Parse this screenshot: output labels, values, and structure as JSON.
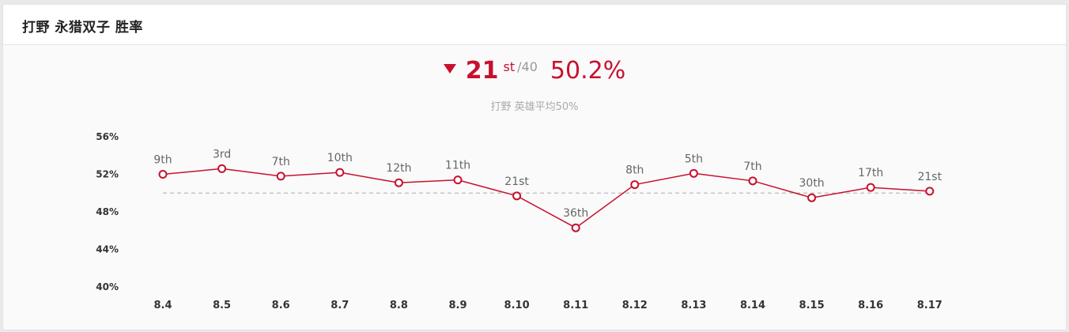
{
  "header": {
    "title": "打野 永猎双子 胜率"
  },
  "summary": {
    "rank": "21",
    "rank_suffix": "st",
    "total": "/40",
    "winrate": "50.2%",
    "trend_icon": "triangle-down-icon",
    "subtitle": "打野 英雄平均50%"
  },
  "colors": {
    "accent": "#c8102e",
    "reference_line": "#bbbbbb",
    "text": "#333333",
    "muted": "#aaaaaa"
  },
  "chart_data": {
    "type": "line",
    "categories": [
      "8.4",
      "8.5",
      "8.6",
      "8.7",
      "8.8",
      "8.9",
      "8.10",
      "8.11",
      "8.12",
      "8.13",
      "8.14",
      "8.15",
      "8.16",
      "8.17"
    ],
    "series": [
      {
        "values": [
          52.0,
          52.6,
          51.8,
          52.2,
          51.1,
          51.4,
          49.7,
          46.3,
          50.9,
          52.1,
          51.3,
          49.5,
          50.6,
          50.2
        ],
        "labels": [
          "9th",
          "3rd",
          "7th",
          "10th",
          "12th",
          "11th",
          "21st",
          "36th",
          "8th",
          "5th",
          "7th",
          "30th",
          "17th",
          "21st"
        ]
      }
    ],
    "reference_line": 50,
    "ylim": [
      40,
      56
    ],
    "yticks": [
      "40%",
      "44%",
      "48%",
      "52%",
      "56%"
    ],
    "ytick_values": [
      40,
      44,
      48,
      52,
      56
    ],
    "grid": false,
    "legend": "none"
  }
}
